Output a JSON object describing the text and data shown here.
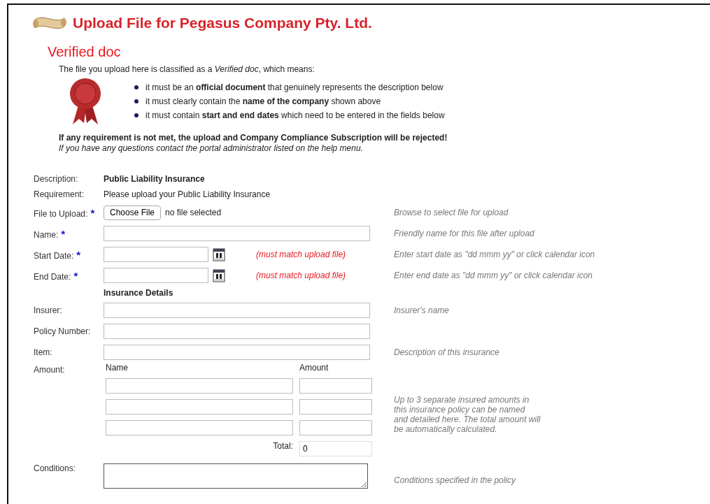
{
  "header": {
    "title": "Upload File for Pegasus Company Pty. Ltd."
  },
  "section_title": "Verified doc",
  "intro": "The file you upload here is classified as a *Verified doc*, which means:",
  "requirements": [
    "it must be an **official document** that genuinely represents the description below",
    "it must clearly contain the **name of the company** shown above",
    "it must contain **start and end dates** which need to be entered in the fields below"
  ],
  "warning": "If any requirement is not met, the upload and Company Compliance Subscription will be rejected!",
  "help_note": "If you have any questions contact the portal administrator listed on the help menu.",
  "details": [
    {
      "label": "Description:",
      "value": "Public Liability Insurance",
      "kind": "bold"
    },
    {
      "label": "Requirement:",
      "value": "Please upload your Public Liability Insurance",
      "kind": "plain"
    }
  ],
  "fields": [
    {
      "kind": "file",
      "label": "File to Upload:",
      "marker": "*",
      "button": "Choose File",
      "status": "no file selected",
      "hint": "Browse to select file for upload"
    },
    {
      "kind": "text",
      "label": "Name:",
      "marker": "*",
      "hint": "Friendly name for this file after upload"
    },
    {
      "kind": "date",
      "label": "Start Date:",
      "marker": "*",
      "note": "(must match upload file)",
      "hint": "Enter start date as \"dd mmm yy\" or click calendar icon"
    },
    {
      "kind": "date",
      "label": "End Date:",
      "marker": "*",
      "note": "(must match upload file)",
      "hint": "Enter end date as \"dd mmm yy\" or click calendar icon"
    },
    {
      "kind": "heading",
      "label": "Insurance Details"
    },
    {
      "kind": "text",
      "label": "Insurer:",
      "hint": "Insurer's name"
    },
    {
      "kind": "text",
      "label": "Policy Number:"
    },
    {
      "kind": "text",
      "label": "Item:",
      "hint": "Description of this insurance"
    },
    {
      "kind": "amounts",
      "label": "Amount:",
      "name_header": "Name",
      "amount_header": "Amount",
      "rows": [
        {
          "kind": "blank"
        },
        {
          "kind": "blank"
        },
        {
          "kind": "blank"
        }
      ],
      "total_label": "Total:",
      "total_value": "0",
      "hint": "Up to 3 separate insured amounts in this insurance policy can be named and detailed here. The total amount will be automatically calculated."
    },
    {
      "kind": "textarea",
      "label": "Conditions:",
      "hint": "Conditions specified in the policy"
    }
  ]
}
